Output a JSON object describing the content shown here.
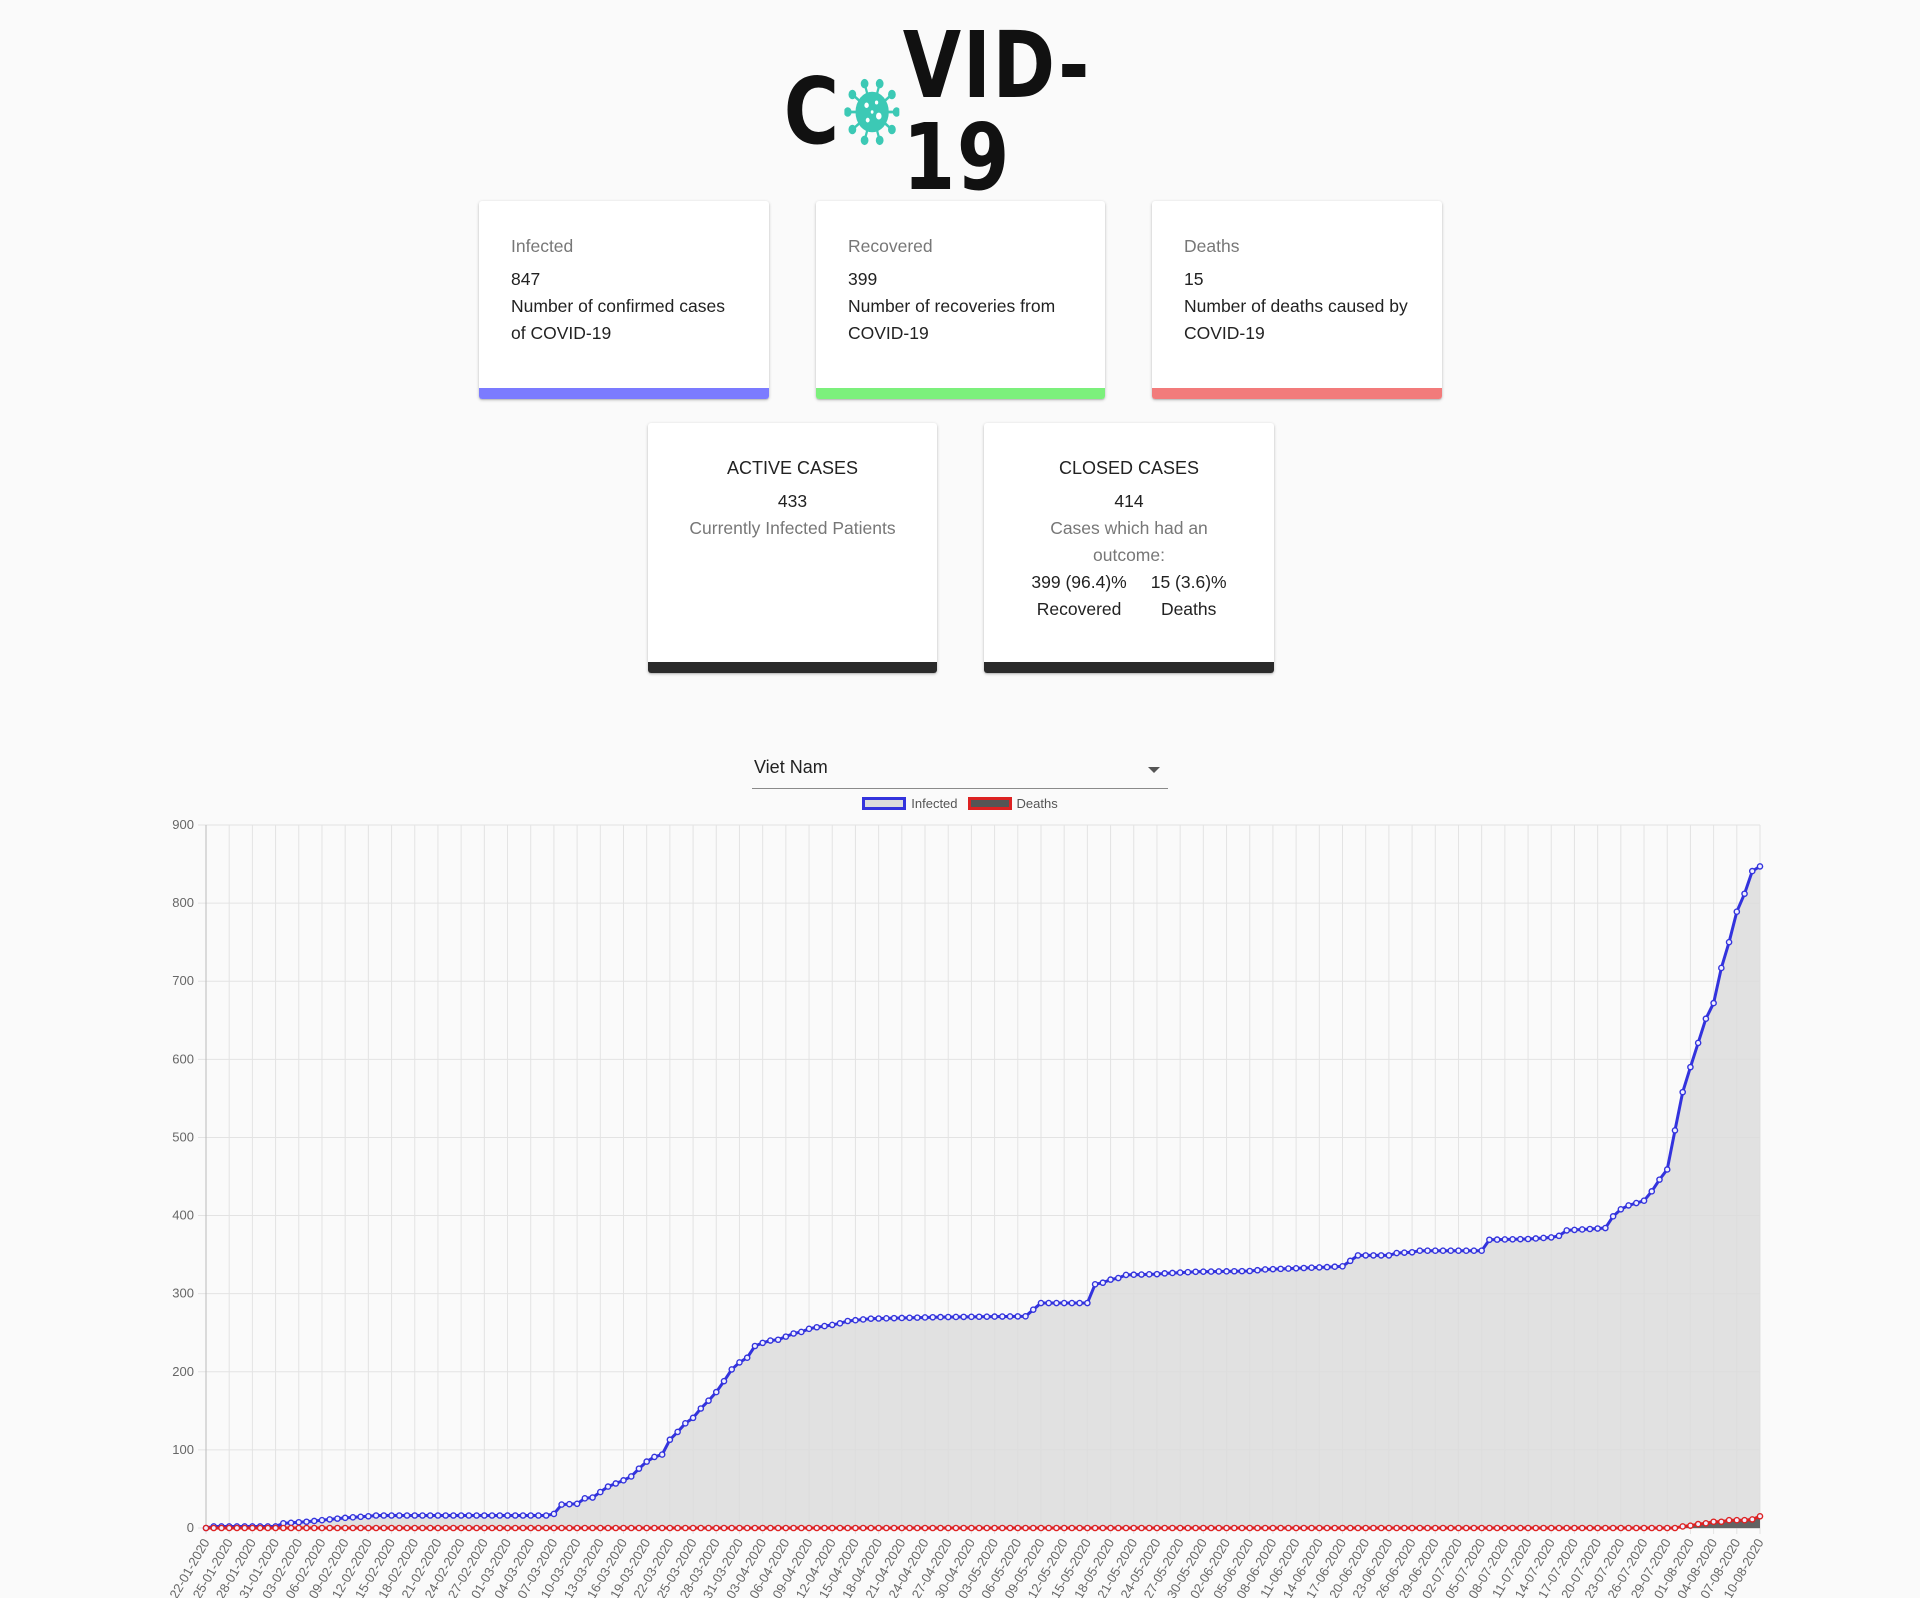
{
  "logo": {
    "text_left": "C",
    "text_right": "VID-19",
    "accent_color": "#3cc9b5"
  },
  "stats": [
    {
      "title": "Infected",
      "value": "847",
      "description": "Number of confirmed cases of COVID-19",
      "color": "#7b7bff"
    },
    {
      "title": "Recovered",
      "value": "399",
      "description": "Number of recoveries from COVID-19",
      "color": "#7cf07c"
    },
    {
      "title": "Deaths",
      "value": "15",
      "description": "Number of deaths caused by COVID-19",
      "color": "#f27b7b"
    }
  ],
  "active": {
    "title": "ACTIVE CASES",
    "value": "433",
    "description": "Currently Infected Patients"
  },
  "closed": {
    "title": "CLOSED CASES",
    "value": "414",
    "description": "Cases which had an outcome:",
    "recovered_value": "399 (96.4)%",
    "recovered_label": "Recovered",
    "deaths_value": "15 (3.6)%",
    "deaths_label": "Deaths"
  },
  "country_select": {
    "value": "Viet Nam"
  },
  "chart_data": {
    "type": "area",
    "title": "",
    "xlabel": "",
    "ylabel": "",
    "ylim": [
      0,
      900
    ],
    "yticks": [
      0,
      100,
      200,
      300,
      400,
      500,
      600,
      700,
      800,
      900
    ],
    "grid": true,
    "legend_position": "top",
    "x_start": "22-01-2020",
    "x_end": "10-08-2020",
    "xtick_labels": [
      "22-01-2020",
      "25-01-2020",
      "28-01-2020",
      "31-01-2020",
      "03-02-2020",
      "06-02-2020",
      "09-02-2020",
      "12-02-2020",
      "15-02-2020",
      "18-02-2020",
      "21-02-2020",
      "24-02-2020",
      "27-02-2020",
      "01-03-2020",
      "04-03-2020",
      "07-03-2020",
      "10-03-2020",
      "13-03-2020",
      "16-03-2020",
      "19-03-2020",
      "22-03-2020",
      "25-03-2020",
      "28-03-2020",
      "31-03-2020",
      "03-04-2020",
      "06-04-2020",
      "09-04-2020",
      "12-04-2020",
      "15-04-2020",
      "18-04-2020",
      "21-04-2020",
      "24-04-2020",
      "27-04-2020",
      "30-04-2020",
      "03-05-2020",
      "06-05-2020",
      "09-05-2020",
      "12-05-2020",
      "15-05-2020",
      "18-05-2020",
      "21-05-2020",
      "24-05-2020",
      "27-05-2020",
      "30-05-2020",
      "02-06-2020",
      "05-06-2020",
      "08-06-2020",
      "11-06-2020",
      "14-06-2020",
      "17-06-2020",
      "20-06-2020",
      "23-06-2020",
      "26-06-2020",
      "29-06-2020",
      "02-07-2020",
      "05-07-2020",
      "08-07-2020",
      "11-07-2020",
      "14-07-2020",
      "17-07-2020",
      "20-07-2020",
      "23-07-2020",
      "26-07-2020",
      "29-07-2020",
      "01-08-2020",
      "04-08-2020",
      "07-08-2020",
      "10-08-2020"
    ],
    "series": [
      {
        "name": "Infected",
        "color": "#3333dd",
        "fill": "#dcdcdc",
        "points": [
          [
            "22-01-2020",
            0
          ],
          [
            "23-01-2020",
            2
          ],
          [
            "31-01-2020",
            2
          ],
          [
            "01-02-2020",
            6
          ],
          [
            "04-02-2020",
            8
          ],
          [
            "06-02-2020",
            10
          ],
          [
            "09-02-2020",
            13
          ],
          [
            "12-02-2020",
            15
          ],
          [
            "13-02-2020",
            16
          ],
          [
            "06-03-2020",
            16
          ],
          [
            "07-03-2020",
            18
          ],
          [
            "08-03-2020",
            30
          ],
          [
            "10-03-2020",
            31
          ],
          [
            "11-03-2020",
            38
          ],
          [
            "12-03-2020",
            39
          ],
          [
            "14-03-2020",
            53
          ],
          [
            "16-03-2020",
            61
          ],
          [
            "17-03-2020",
            66
          ],
          [
            "18-03-2020",
            76
          ],
          [
            "19-03-2020",
            85
          ],
          [
            "20-03-2020",
            91
          ],
          [
            "21-03-2020",
            94
          ],
          [
            "22-03-2020",
            113
          ],
          [
            "23-03-2020",
            123
          ],
          [
            "24-03-2020",
            134
          ],
          [
            "25-03-2020",
            141
          ],
          [
            "26-03-2020",
            153
          ],
          [
            "27-03-2020",
            163
          ],
          [
            "28-03-2020",
            174
          ],
          [
            "29-03-2020",
            188
          ],
          [
            "30-03-2020",
            203
          ],
          [
            "31-03-2020",
            212
          ],
          [
            "01-04-2020",
            218
          ],
          [
            "02-04-2020",
            233
          ],
          [
            "03-04-2020",
            237
          ],
          [
            "04-04-2020",
            240
          ],
          [
            "05-04-2020",
            241
          ],
          [
            "06-04-2020",
            245
          ],
          [
            "07-04-2020",
            249
          ],
          [
            "08-04-2020",
            251
          ],
          [
            "09-04-2020",
            255
          ],
          [
            "10-04-2020",
            257
          ],
          [
            "12-04-2020",
            260
          ],
          [
            "13-04-2020",
            262
          ],
          [
            "14-04-2020",
            265
          ],
          [
            "15-04-2020",
            266
          ],
          [
            "16-04-2020",
            267
          ],
          [
            "17-04-2020",
            268
          ],
          [
            "26-04-2020",
            270
          ],
          [
            "07-05-2020",
            271
          ],
          [
            "09-05-2020",
            288
          ],
          [
            "15-05-2020",
            288
          ],
          [
            "16-05-2020",
            312
          ],
          [
            "17-05-2020",
            314
          ],
          [
            "18-05-2020",
            318
          ],
          [
            "19-05-2020",
            320
          ],
          [
            "20-05-2020",
            324
          ],
          [
            "24-05-2020",
            325
          ],
          [
            "25-05-2020",
            326
          ],
          [
            "27-05-2020",
            327
          ],
          [
            "29-05-2020",
            328
          ],
          [
            "05-06-2020",
            329
          ],
          [
            "07-06-2020",
            331
          ],
          [
            "15-06-2020",
            334
          ],
          [
            "17-06-2020",
            335
          ],
          [
            "18-06-2020",
            342
          ],
          [
            "19-06-2020",
            349
          ],
          [
            "23-06-2020",
            349
          ],
          [
            "24-06-2020",
            352
          ],
          [
            "26-06-2020",
            353
          ],
          [
            "27-06-2020",
            355
          ],
          [
            "02-07-2020",
            355
          ],
          [
            "05-07-2020",
            355
          ],
          [
            "06-07-2020",
            369
          ],
          [
            "11-07-2020",
            370
          ],
          [
            "14-07-2020",
            372
          ],
          [
            "15-07-2020",
            374
          ],
          [
            "16-07-2020",
            381
          ],
          [
            "21-07-2020",
            384
          ],
          [
            "22-07-2020",
            399
          ],
          [
            "23-07-2020",
            408
          ],
          [
            "24-07-2020",
            413
          ],
          [
            "25-07-2020",
            416
          ],
          [
            "26-07-2020",
            419
          ],
          [
            "27-07-2020",
            431
          ],
          [
            "28-07-2020",
            446
          ],
          [
            "29-07-2020",
            459
          ],
          [
            "30-07-2020",
            509
          ],
          [
            "31-07-2020",
            558
          ],
          [
            "01-08-2020",
            590
          ],
          [
            "02-08-2020",
            621
          ],
          [
            "03-08-2020",
            652
          ],
          [
            "04-08-2020",
            672
          ],
          [
            "05-08-2020",
            717
          ],
          [
            "06-08-2020",
            750
          ],
          [
            "07-08-2020",
            789
          ],
          [
            "08-08-2020",
            812
          ],
          [
            "09-08-2020",
            841
          ],
          [
            "10-08-2020",
            847
          ]
        ]
      },
      {
        "name": "Deaths",
        "color": "#dd2222",
        "fill": "#555555",
        "points": [
          [
            "22-01-2020",
            0
          ],
          [
            "30-07-2020",
            0
          ],
          [
            "31-07-2020",
            2
          ],
          [
            "01-08-2020",
            3
          ],
          [
            "02-08-2020",
            5
          ],
          [
            "03-08-2020",
            6
          ],
          [
            "04-08-2020",
            8
          ],
          [
            "05-08-2020",
            8
          ],
          [
            "06-08-2020",
            10
          ],
          [
            "07-08-2020",
            10
          ],
          [
            "08-08-2020",
            10
          ],
          [
            "09-08-2020",
            11
          ],
          [
            "10-08-2020",
            15
          ]
        ]
      }
    ]
  }
}
